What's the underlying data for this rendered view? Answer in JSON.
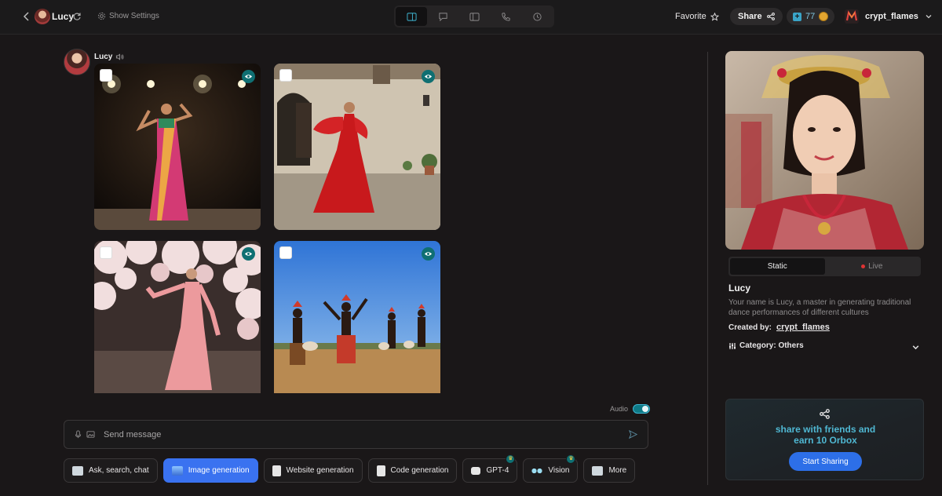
{
  "topbar": {
    "bot_name": "Lucy",
    "show_settings": "Show Settings",
    "favorite": "Favorite",
    "share": "Share",
    "credits": "77",
    "username": "crypt_flames"
  },
  "chat": {
    "sender": "Lucy",
    "images": [
      {
        "alt": "sari dancer on stage"
      },
      {
        "alt": "flamenco dancer in red dress"
      },
      {
        "alt": "dancer under cherry blossoms"
      },
      {
        "alt": "tribal drummers and dancers"
      }
    ],
    "audio_label": "Audio",
    "audio_on": true,
    "input_placeholder": "Send message"
  },
  "tools": [
    {
      "label": "Ask, search, chat",
      "active": false
    },
    {
      "label": "Image generation",
      "active": true
    },
    {
      "label": "Website generation",
      "active": false
    },
    {
      "label": "Code generation",
      "active": false
    },
    {
      "label": "GPT-4",
      "active": false,
      "premium": true
    },
    {
      "label": "Vision",
      "active": false,
      "premium": true
    },
    {
      "label": "More",
      "active": false
    }
  ],
  "profile": {
    "tab_static": "Static",
    "tab_live": "Live",
    "name": "Lucy",
    "description": "Your name is Lucy, a master in generating traditional dance performances of different cultures",
    "created_by_label": "Created by:",
    "created_by": "crypt_flames",
    "category": "Category: Others"
  },
  "share_card": {
    "line1": "share with friends and",
    "line2": "earn 10 Orbox",
    "button": "Start Sharing"
  },
  "colors": {
    "accent": "#3fb7d4",
    "primary_button": "#2d6fe8",
    "background": "#1a1718"
  }
}
